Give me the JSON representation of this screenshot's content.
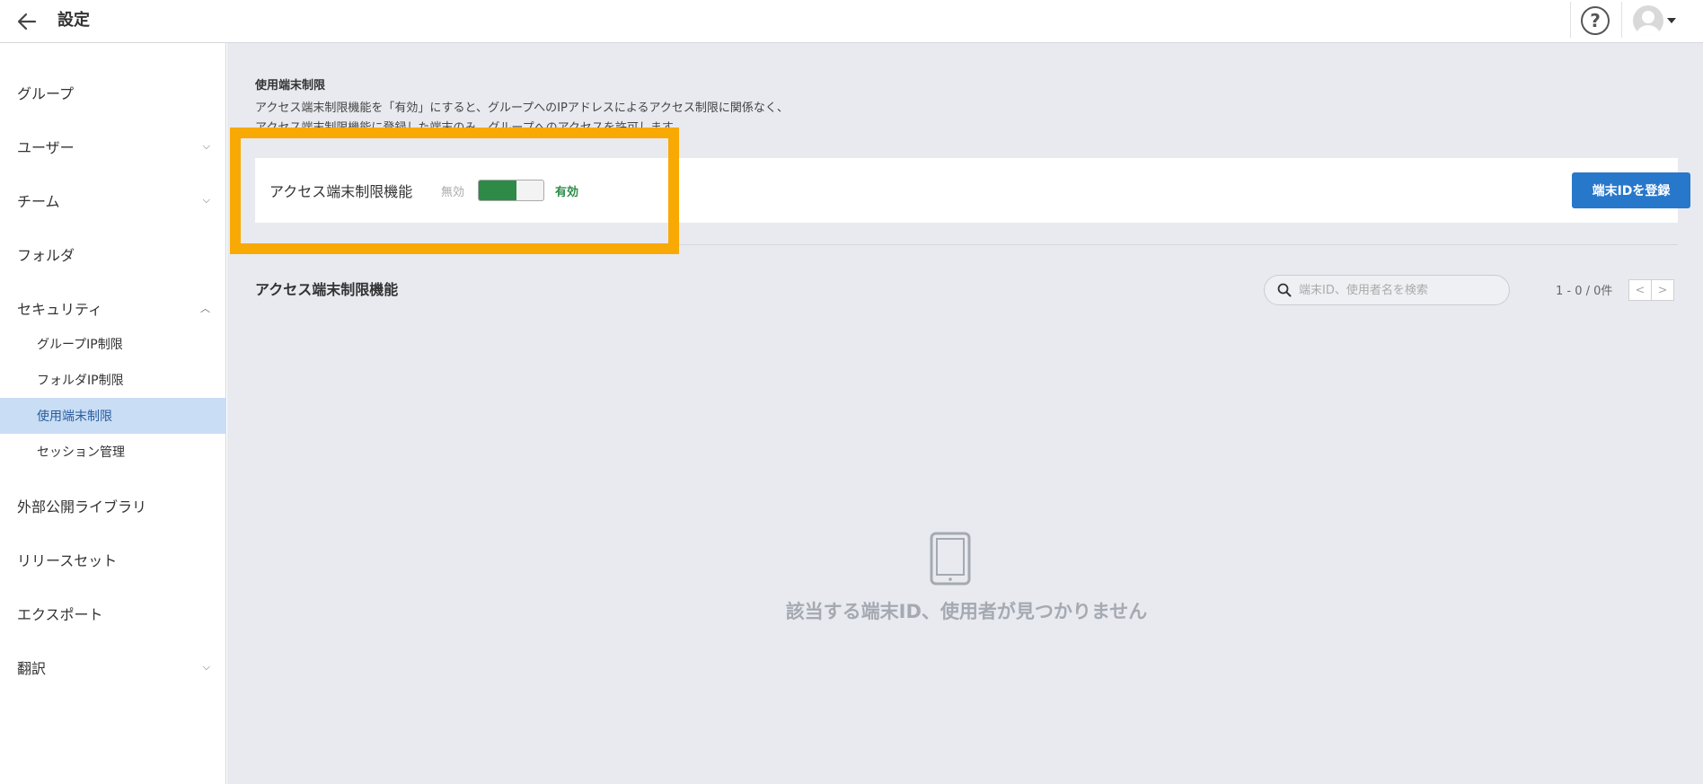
{
  "header": {
    "title": "設定",
    "help_label": "?"
  },
  "sidebar": {
    "items": [
      {
        "label": "グループ"
      },
      {
        "label": "ユーザー"
      },
      {
        "label": "チーム"
      },
      {
        "label": "フォルダ"
      },
      {
        "label": "セキュリティ"
      },
      {
        "label": "外部公開ライブラリ"
      },
      {
        "label": "リリースセット"
      },
      {
        "label": "エクスポート"
      },
      {
        "label": "翻訳"
      }
    ],
    "security_sub": [
      {
        "label": "グループIP制限"
      },
      {
        "label": "フォルダIP制限"
      },
      {
        "label": "使用端末制限"
      },
      {
        "label": "セッション管理"
      }
    ],
    "active_item": "使用端末制限"
  },
  "main": {
    "section_title": "使用端末制限",
    "section_desc_line1": "アクセス端末制限機能を「有効」にすると、グループへのIPアドレスによるアクセス制限に関係なく、",
    "section_desc_line2": "アクセス端末制限機能に登録した端末のみ、グループへのアクセスを許可します。",
    "card": {
      "label": "アクセス端末制限機能",
      "toggle_off_label": "無効",
      "toggle_on_label": "有効",
      "toggle_state": "on",
      "register_button": "端末IDを登録"
    },
    "list": {
      "title": "アクセス端末制限機能",
      "search_placeholder": "端末ID、使用者名を検索",
      "pager_text": "1 - 0 / 0件",
      "prev_label": "<",
      "next_label": ">",
      "empty_message": "該当する端末ID、使用者が見つかりません"
    }
  },
  "colors": {
    "accent": "#2777cb",
    "toggle_on": "#2e8b47",
    "highlight": "#f8a904",
    "active_nav_bg": "#c9ddf4"
  },
  "icons": [
    "back-arrow-icon",
    "help-icon",
    "avatar-icon",
    "chevron-down-icon",
    "chevron-up-icon",
    "search-icon",
    "tablet-icon",
    "chevron-left-icon",
    "chevron-right-icon"
  ]
}
